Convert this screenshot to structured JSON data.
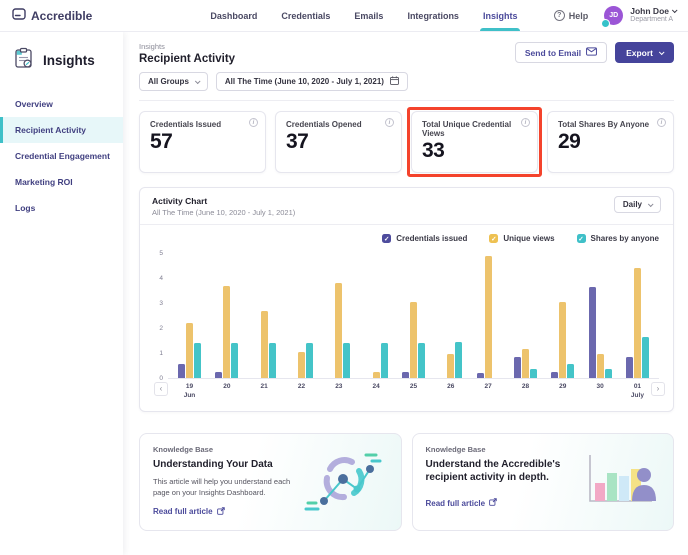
{
  "topbar": {
    "brand": "Accredible",
    "nav": [
      {
        "label": "Dashboard"
      },
      {
        "label": "Credentials"
      },
      {
        "label": "Emails"
      },
      {
        "label": "Integrations"
      },
      {
        "label": "Insights"
      }
    ],
    "help_label": "Help",
    "user": {
      "initials": "JD",
      "name": "John Doe",
      "department": "Department A"
    }
  },
  "sidebar": {
    "title": "Insights",
    "items": [
      {
        "label": "Overview"
      },
      {
        "label": "Recipient Activity"
      },
      {
        "label": "Credential Engagement"
      },
      {
        "label": "Marketing ROI"
      },
      {
        "label": "Logs"
      }
    ]
  },
  "header": {
    "breadcrumb": "Insights",
    "title": "Recipient Activity",
    "group_filter": "All Groups",
    "date_filter": "All The Time (June 10, 2020 - July 1, 2021)",
    "send_to_email_label": "Send to Email",
    "export_label": "Export"
  },
  "stats": [
    {
      "label": "Credentials Issued",
      "value": "57"
    },
    {
      "label": "Credentials Opened",
      "value": "37"
    },
    {
      "label": "Total Unique Credential Views",
      "value": "33"
    },
    {
      "label": "Total Shares By Anyone",
      "value": "29"
    }
  ],
  "chart": {
    "title": "Activity Chart",
    "subtitle": "All The Time (June 10, 2020 - July 1, 2021)",
    "interval": "Daily"
  },
  "chart_data": {
    "type": "bar",
    "title": "Activity Chart",
    "x": [
      "19 Jun",
      "20",
      "21",
      "22",
      "23",
      "24",
      "25",
      "26",
      "27",
      "28",
      "29",
      "30",
      "01 July"
    ],
    "series": [
      {
        "name": "Credentials issued",
        "color": "#6b68ae",
        "legend_color": "#4e4c9d",
        "values": [
          0.55,
          0.25,
          0,
          0,
          0,
          0,
          0.25,
          0,
          0.2,
          0.85,
          0.25,
          3.65,
          0.85
        ]
      },
      {
        "name": "Unique views",
        "color": "#edc36c",
        "legend_color": "#eec152",
        "values": [
          2.2,
          3.7,
          2.7,
          1.05,
          3.8,
          0.25,
          3.05,
          0.95,
          4.9,
          1.15,
          3.05,
          0.95,
          4.4
        ]
      },
      {
        "name": "Shares by anyone",
        "color": "#44c4c8",
        "legend_color": "#3fc0c8",
        "values": [
          1.4,
          1.4,
          1.4,
          1.4,
          1.4,
          1.4,
          1.4,
          1.45,
          0,
          0.35,
          0.55,
          0.35,
          1.65
        ]
      }
    ],
    "ylim": [
      0,
      5
    ],
    "yticks": [
      0,
      1,
      2,
      3,
      4,
      5
    ],
    "legend_position": "top-right",
    "grid": false
  },
  "knowledge": [
    {
      "kicker": "Knowledge Base",
      "title": "Understanding Your Data",
      "body": "This article will help you understand each page on your Insights Dashboard.",
      "link": "Read full article"
    },
    {
      "kicker": "Knowledge Base",
      "title": "Understand the Accredible's recipient activity in depth.",
      "body": "",
      "link": "Read full article"
    }
  ],
  "colors": {
    "accent_teal": "#3fc0c8",
    "primary_indigo": "#45449b",
    "highlight_red": "#f4432c"
  }
}
